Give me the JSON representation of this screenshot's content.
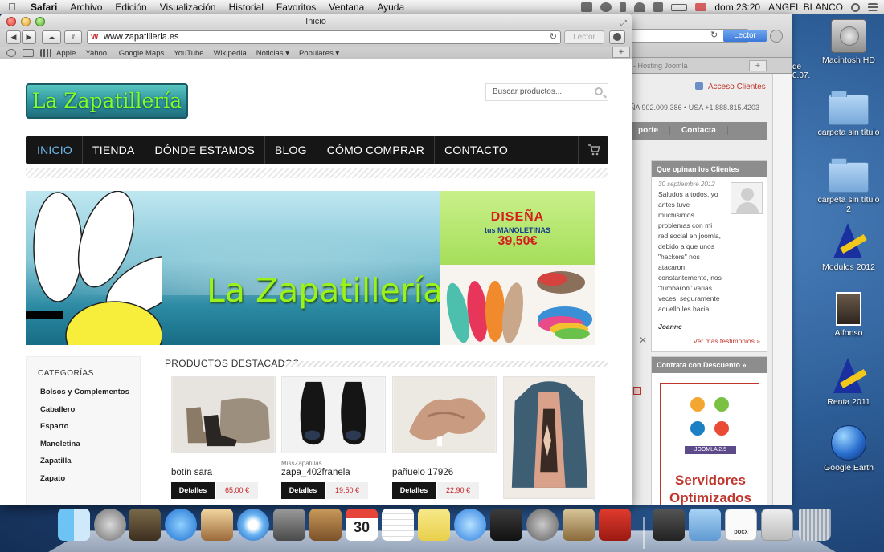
{
  "menubar": {
    "app": "Safari",
    "menus": [
      "Archivo",
      "Edición",
      "Visualización",
      "Historial",
      "Favoritos",
      "Ventana",
      "Ayuda"
    ],
    "clock": "dom 23:20",
    "user": "ANGEL BLANCO",
    "status_icons": [
      "screen-icon",
      "time-machine-icon",
      "bluetooth-icon",
      "wifi-icon",
      "volume-icon",
      "battery-icon",
      "flag-icon",
      "spotlight-icon",
      "list-icon"
    ]
  },
  "safari": {
    "window_title": "Inicio",
    "url": "www.zapatilleria.es",
    "reader_label": "Lector",
    "bookmarks": [
      "Apple",
      "Yahoo!",
      "Google Maps",
      "YouTube",
      "Wikipedia",
      "Noticias ▾",
      "Populares ▾"
    ]
  },
  "site": {
    "logo_text": "La Zapatillería",
    "search_placeholder": "Buscar productos...",
    "nav": [
      "INICIO",
      "TIENDA",
      "DÓNDE ESTAMOS",
      "BLOG",
      "CÓMO COMPRAR",
      "CONTACTO"
    ],
    "banner_title": "La Zapatillería",
    "promo": {
      "line1": "DISEÑA",
      "line2": "tus MANOLETINAS",
      "price": "39,50€"
    },
    "categories_title": "CATEGORÍAS",
    "categories": [
      "Bolsos y Complementos",
      "Caballero",
      "Esparto",
      "Manoletina",
      "Zapatilla",
      "Zapato"
    ],
    "featured_title": "PRODUCTOS DESTACADOS",
    "products": [
      {
        "maker": "",
        "name": "botín sara",
        "button": "Detalles",
        "price": "65,00 €"
      },
      {
        "maker": "MissZapatillas",
        "name": "zapa_402franela",
        "button": "Detalles",
        "price": "19,50 €"
      },
      {
        "maker": "",
        "name": "pañuelo 17926",
        "button": "Detalles",
        "price": "22,90 €"
      }
    ]
  },
  "background_window": {
    "tab_label": "- Hosting Joomla",
    "reader_label": "Lector",
    "acceso": "Acceso Clientes",
    "phone": "ÑA 902.009.386 • USA +1.888.815.4203",
    "nav": [
      "porte",
      "Contacta"
    ],
    "testimonials_header": "Que opinan los Clientes",
    "testimonial_date": "30 septiembre 2012",
    "testimonial_text": "Saludos a todos, yo antes tuve muchisimos problemas con mi red social en joomla, debido a que unos \"hackers\" nos atacaron constantemente, nos \"tumbaron\" varias veces, seguramente aquello les hacia ...",
    "testimonial_name": "Joanne",
    "more_testimonials": "Ver más testimonios »",
    "discount_header": "Contrata con Descuento »",
    "joomla_badge": "JOOMLA 2.5",
    "ad_text": "Servidores Optimizados Joomla!",
    "fragment_de": "de",
    "fragment_date": "0.07."
  },
  "desktop_icons": [
    {
      "label": "Macintosh HD",
      "icon": "hard-drive-icon"
    },
    {
      "label": "carpeta sin título",
      "icon": "folder-icon"
    },
    {
      "label": "carpeta sin título 2",
      "icon": "folder-icon"
    },
    {
      "label": "Modulos 2012",
      "icon": "aeat-icon"
    },
    {
      "label": "Alfonso",
      "icon": "photo-icon"
    },
    {
      "label": "Renta 2011",
      "icon": "aeat-icon"
    },
    {
      "label": "Google Earth",
      "icon": "google-earth-icon"
    }
  ],
  "dock": {
    "items": [
      "finder-icon",
      "launchpad-icon",
      "photo-booth-icon",
      "app-store-icon",
      "preview-icon",
      "safari-icon",
      "facetime-icon",
      "contacts-icon",
      "calendar-icon",
      "reminders-icon",
      "notes-icon",
      "itunes-icon",
      "imovie-icon",
      "system-preferences-icon",
      "iphoto-icon",
      "acrobat-icon",
      "downloads-stack-icon",
      "applications-stack-icon",
      "docx-file-icon",
      "screenshot-file-icon",
      "trash-icon"
    ],
    "calendar_day": "30",
    "docx_label": "DOCX"
  },
  "colors": {
    "nav_active": "#6fb7ea",
    "price_red": "#c8252a",
    "logo_green": "#7cff2a"
  }
}
